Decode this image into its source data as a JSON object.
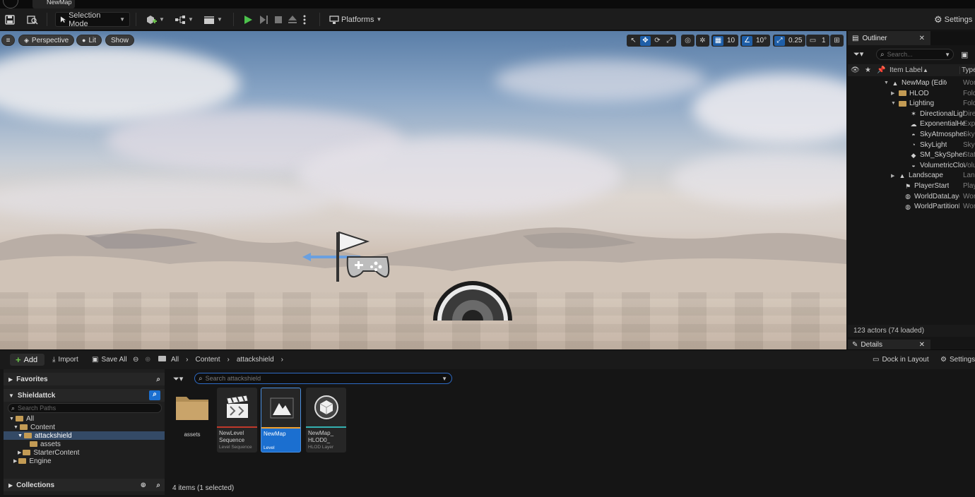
{
  "titlebar": {
    "tab_label": "NewMap"
  },
  "toolbar": {
    "selection_mode": "Selection Mode",
    "platforms": "Platforms",
    "settings": "Settings"
  },
  "viewport": {
    "perspective": "Perspective",
    "lit": "Lit",
    "show": "Show",
    "grid_snap": "10",
    "rotation_snap": "10°",
    "scale_snap": "0.25",
    "camera_speed": "1"
  },
  "outliner": {
    "tab_label": "Outliner",
    "search_placeholder": "Search...",
    "col_item_label": "Item Label",
    "col_type": "Type",
    "rows": [
      {
        "label": "NewMap (Editor)",
        "type": "World"
      },
      {
        "label": "HLOD",
        "type": "Folder"
      },
      {
        "label": "Lighting",
        "type": "Folder"
      },
      {
        "label": "DirectionalLight",
        "type": "DirectionalLight"
      },
      {
        "label": "ExponentialHeightFog",
        "type": "ExponentialHeightFog"
      },
      {
        "label": "SkyAtmosphere",
        "type": "SkyAtmosphere"
      },
      {
        "label": "SkyLight",
        "type": "SkyLight"
      },
      {
        "label": "SM_SkySphere",
        "type": "StaticMeshActor"
      },
      {
        "label": "VolumetricCloud",
        "type": "VolumetricCloud"
      },
      {
        "label": "Landscape",
        "type": "Landscape"
      },
      {
        "label": "PlayerStart",
        "type": "PlayerStart"
      },
      {
        "label": "WorldDataLayers",
        "type": "WorldDataLayers"
      },
      {
        "label": "WorldPartitionMiniMap",
        "type": "WorldPartitionMiniMap"
      }
    ],
    "status": "123 actors (74 loaded)",
    "details_tab": "Details"
  },
  "content_browser": {
    "add": "Add",
    "import": "Import",
    "save_all": "Save All",
    "breadcrumb": [
      "All",
      "Content",
      "attackshield"
    ],
    "dock_in_layout": "Dock in Layout",
    "settings": "Settings",
    "favorites": "Favorites",
    "project": "Shieldattck",
    "search_paths_placeholder": "Search Paths",
    "search_assets_placeholder": "Search attackshield",
    "tree": [
      {
        "label": "All"
      },
      {
        "label": "Content"
      },
      {
        "label": "attackshield"
      },
      {
        "label": "assets"
      },
      {
        "label": "StarterContent"
      },
      {
        "label": "Engine"
      }
    ],
    "collections": "Collections",
    "assets": [
      {
        "name": "assets",
        "type": ""
      },
      {
        "name": "NewLevel Sequence",
        "type": "Level Sequence"
      },
      {
        "name": "NewMap",
        "type": "Level"
      },
      {
        "name": "NewMap_ HLOD0_",
        "type": "HLOD Layer"
      }
    ],
    "status": "4 items (1 selected)"
  }
}
